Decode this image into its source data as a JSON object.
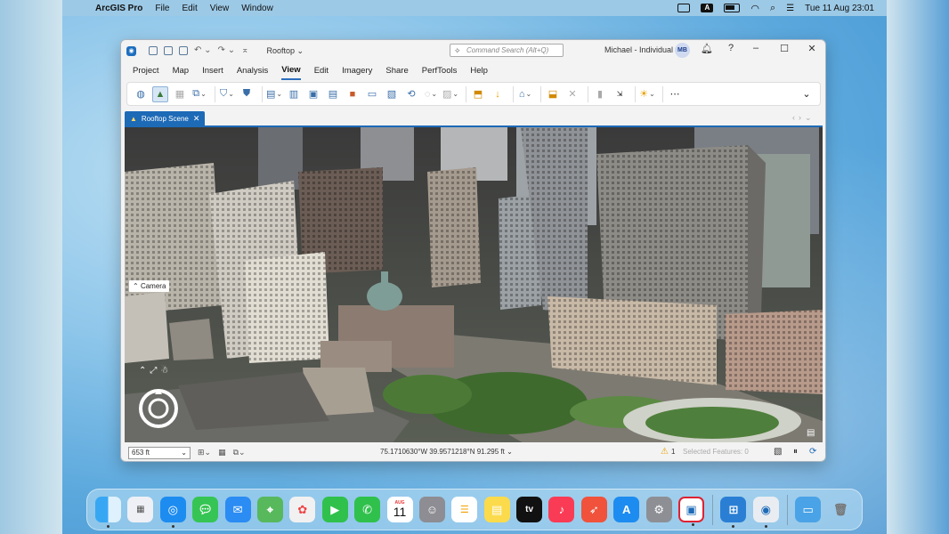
{
  "menubar": {
    "app": "ArcGIS Pro",
    "items": [
      "File",
      "Edit",
      "View",
      "Window"
    ],
    "keyboard_badge": "A",
    "datetime": "Tue 11 Aug  23:01"
  },
  "window": {
    "title_dropdown": "Rooftop",
    "search_placeholder": "Command Search (Alt+Q)",
    "user": "Michael - Individual",
    "avatar_initials": "MB",
    "help": "?",
    "tabs": [
      "Project",
      "Map",
      "Insert",
      "Analysis",
      "View",
      "Edit",
      "Imagery",
      "Share",
      "PerfTools",
      "Help"
    ],
    "active_tab": "View"
  },
  "view": {
    "tab_label": "Rooftop Scene",
    "camera_label": "Camera"
  },
  "status": {
    "scale": "653 ft",
    "coordinates": "75.1710630°W 39.9571218°N",
    "elevation": "91.295 ft",
    "warnings": "1",
    "selected_features": "Selected Features: 0"
  },
  "dock": {
    "calendar_month": "AUG",
    "calendar_day": "11",
    "tv_label": "tv"
  },
  "colors": {
    "accent": "#1d6ab7",
    "warning": "#e7a100"
  }
}
